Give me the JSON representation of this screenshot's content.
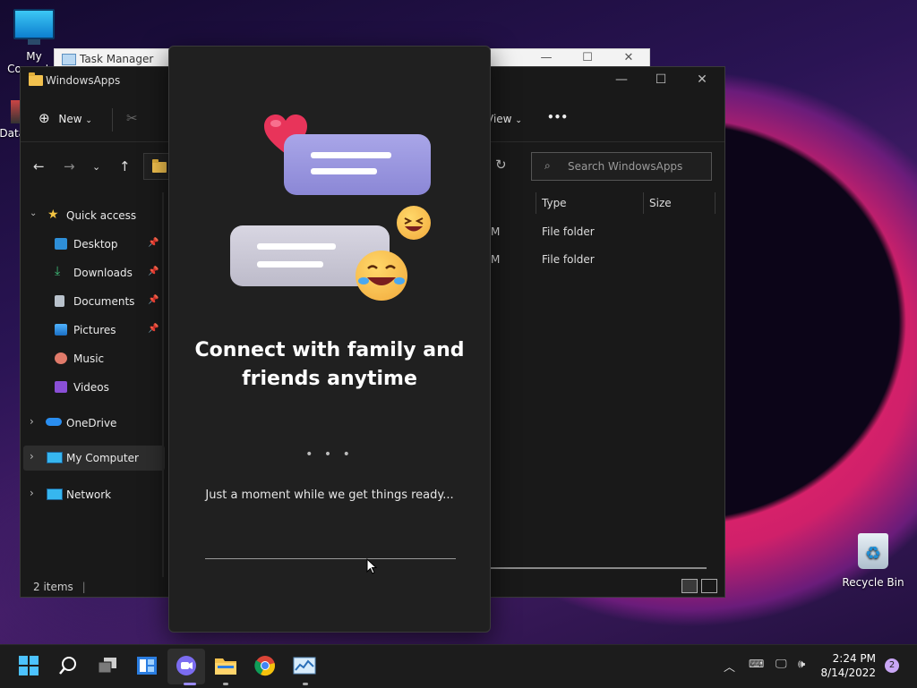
{
  "desktop": {
    "icons": [
      {
        "label": "My Computer"
      },
      {
        "label": "Data"
      },
      {
        "label": "Recycle Bin"
      }
    ]
  },
  "task_manager": {
    "title": "Task Manager"
  },
  "explorer": {
    "title": "WindowsApps",
    "toolbar": {
      "new_label": "New",
      "view_label": "View",
      "more_label": "•••"
    },
    "search_placeholder": "Search WindowsApps",
    "sidebar": {
      "quick_access": "Quick access",
      "items": [
        {
          "label": "Desktop",
          "pinned": true
        },
        {
          "label": "Downloads",
          "pinned": true
        },
        {
          "label": "Documents",
          "pinned": true
        },
        {
          "label": "Pictures",
          "pinned": true
        },
        {
          "label": "Music",
          "pinned": false
        },
        {
          "label": "Videos",
          "pinned": false
        }
      ],
      "onedrive": "OneDrive",
      "my_computer": "My Computer",
      "network": "Network"
    },
    "columns": {
      "type": "Type",
      "size": "Size"
    },
    "rows": [
      {
        "date_tail": "M",
        "type": "File folder"
      },
      {
        "date_tail": "M",
        "type": "File folder"
      }
    ],
    "status": "2 items"
  },
  "teams_dialog": {
    "headline": "Connect with family and friends anytime",
    "dots": "• • •",
    "subtext": "Just a moment while we get things ready..."
  },
  "taskbar": {
    "time": "2:24 PM",
    "date": "8/14/2022",
    "notification_count": "2"
  }
}
